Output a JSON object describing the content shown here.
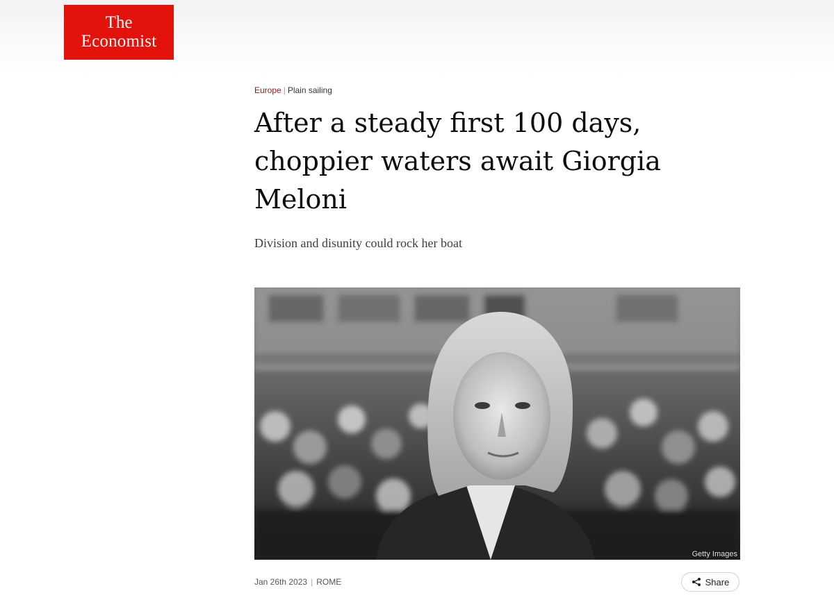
{
  "masthead": {
    "logo_line1": "The",
    "logo_line2": "Economist",
    "brand_color": "#e3120b"
  },
  "article": {
    "section": "Europe",
    "rubric": "Plain sailing",
    "headline": "After a steady first 100 days, choppier waters await Giorgia Meloni",
    "subheadline": "Division and disunity could rock her boat",
    "image_credit": "Getty Images",
    "date": "Jan 26th 2023",
    "dateline": "ROME",
    "share_label": "Share",
    "share_icon": "share-icon"
  }
}
